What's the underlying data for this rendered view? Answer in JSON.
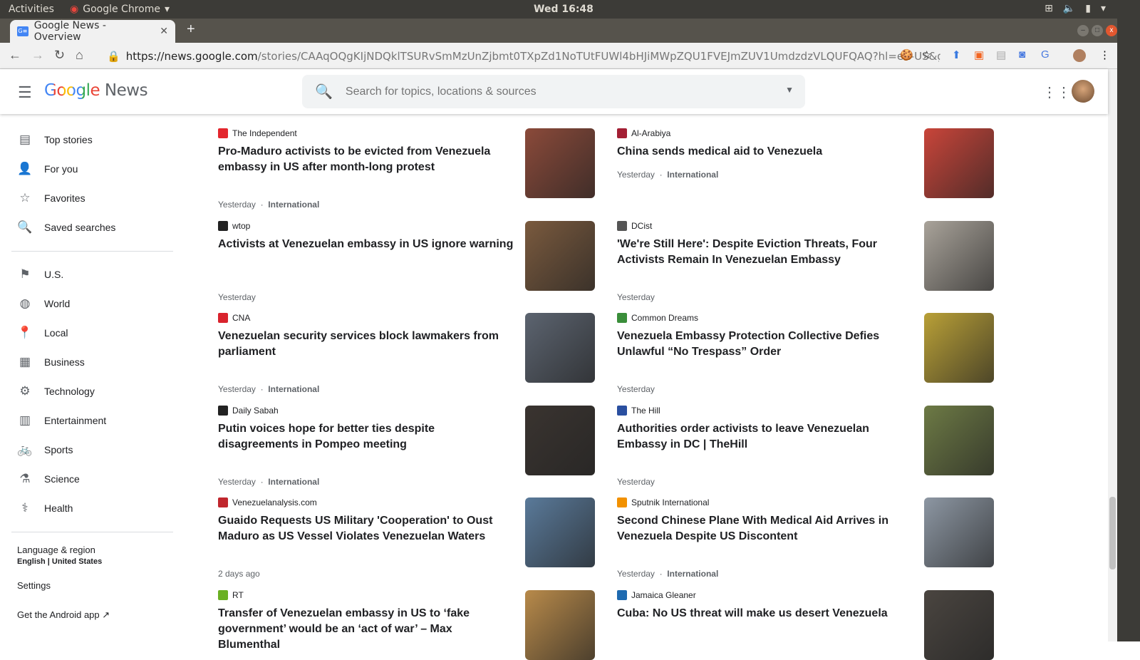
{
  "system": {
    "activities": "Activities",
    "app": "Google Chrome",
    "clock": "Wed 16:48"
  },
  "browser": {
    "tab_title": "Google News - Overview",
    "url_host": "https://news.google.com",
    "url_path": "/stories/CAAqOQgKIjNDQklTSURvSmMzUnZjbmt0TXpZd1NoTUtFUWl4bHJiMWpZQU1FVEJmZUV1UmdzdzVLQUFQAQ?hl=en-US&gl=US&ceid=US..."
  },
  "header": {
    "logo_google": "Google",
    "logo_news": "News",
    "search_placeholder": "Search for topics, locations & sources"
  },
  "sidebar": {
    "items": [
      {
        "label": "Top stories",
        "icon": "▤"
      },
      {
        "label": "For you",
        "icon": "👤"
      },
      {
        "label": "Favorites",
        "icon": "☆"
      },
      {
        "label": "Saved searches",
        "icon": "🔍"
      }
    ],
    "sections": [
      {
        "label": "U.S.",
        "icon": "⚑"
      },
      {
        "label": "World",
        "icon": "◍"
      },
      {
        "label": "Local",
        "icon": "📍"
      },
      {
        "label": "Business",
        "icon": "▦"
      },
      {
        "label": "Technology",
        "icon": "⚙"
      },
      {
        "label": "Entertainment",
        "icon": "▥"
      },
      {
        "label": "Sports",
        "icon": "🚲"
      },
      {
        "label": "Science",
        "icon": "⚗"
      },
      {
        "label": "Health",
        "icon": "⚕"
      }
    ],
    "language_label": "Language & region",
    "language_value": "English | United States",
    "settings": "Settings",
    "android": "Get the Android app"
  },
  "articles": [
    {
      "source": "The Independent",
      "title": "Pro-Maduro activists to be evicted from Venezuela embassy in US after month-long protest",
      "time": "Yesterday",
      "tag": "International",
      "color": "#e3262d",
      "thumb": "#8b4a3a"
    },
    {
      "source": "Al-Arabiya",
      "title": "China sends medical aid to Venezuela",
      "time": "Yesterday",
      "tag": "International",
      "color": "#a31f34",
      "thumb": "#c9453a"
    },
    {
      "source": "wtop",
      "title": "Activists at Venezuelan embassy in US ignore warning",
      "time": "Yesterday",
      "tag": "",
      "color": "#222",
      "thumb": "#7a5a3e"
    },
    {
      "source": "DCist",
      "title": "'We're Still Here': Despite Eviction Threats, Four Activists Remain In Venezuelan Embassy",
      "time": "Yesterday",
      "tag": "",
      "color": "#555",
      "thumb": "#a9a39a"
    },
    {
      "source": "CNA",
      "title": "Venezuelan security services block lawmakers from parliament",
      "time": "Yesterday",
      "tag": "International",
      "color": "#d9232d",
      "thumb": "#5c6470"
    },
    {
      "source": "Common Dreams",
      "title": "Venezuela Embassy Protection Collective Defies Unlawful “No Trespass” Order",
      "time": "Yesterday",
      "tag": "",
      "color": "#3a8e3a",
      "thumb": "#b9a037"
    },
    {
      "source": "Daily Sabah",
      "title": "Putin voices hope for better ties despite disagreements in Pompeo meeting",
      "time": "Yesterday",
      "tag": "International",
      "color": "#222",
      "thumb": "#3a3430"
    },
    {
      "source": "The Hill",
      "title": "Authorities order activists to leave Venezuelan Embassy in DC | TheHill",
      "time": "Yesterday",
      "tag": "",
      "color": "#2a4fa0",
      "thumb": "#6d7a45"
    },
    {
      "source": "Venezuelanalysis.com",
      "title": "Guaido Requests US Military 'Cooperation' to Oust Maduro as US Vessel Violates Venezuelan Waters",
      "time": "2 days ago",
      "tag": "",
      "color": "#c0262d",
      "thumb": "#5a7a9a"
    },
    {
      "source": "Sputnik International",
      "title": "Second Chinese Plane With Medical Aid Arrives in Venezuela Despite US Discontent",
      "time": "Yesterday",
      "tag": "International",
      "color": "#f29100",
      "thumb": "#8d97a3"
    },
    {
      "source": "RT",
      "title": "Transfer of Venezuelan embassy in US to ‘fake government’ would be an ‘act of war’ – Max Blumenthal",
      "time": "",
      "tag": "",
      "color": "#6ab023",
      "thumb": "#b88a4a"
    },
    {
      "source": "Jamaica Gleaner",
      "title": "Cuba: No US threat will make us desert Venezuela",
      "time": "",
      "tag": "",
      "color": "#1e6ab0",
      "thumb": "#4a4540"
    }
  ]
}
